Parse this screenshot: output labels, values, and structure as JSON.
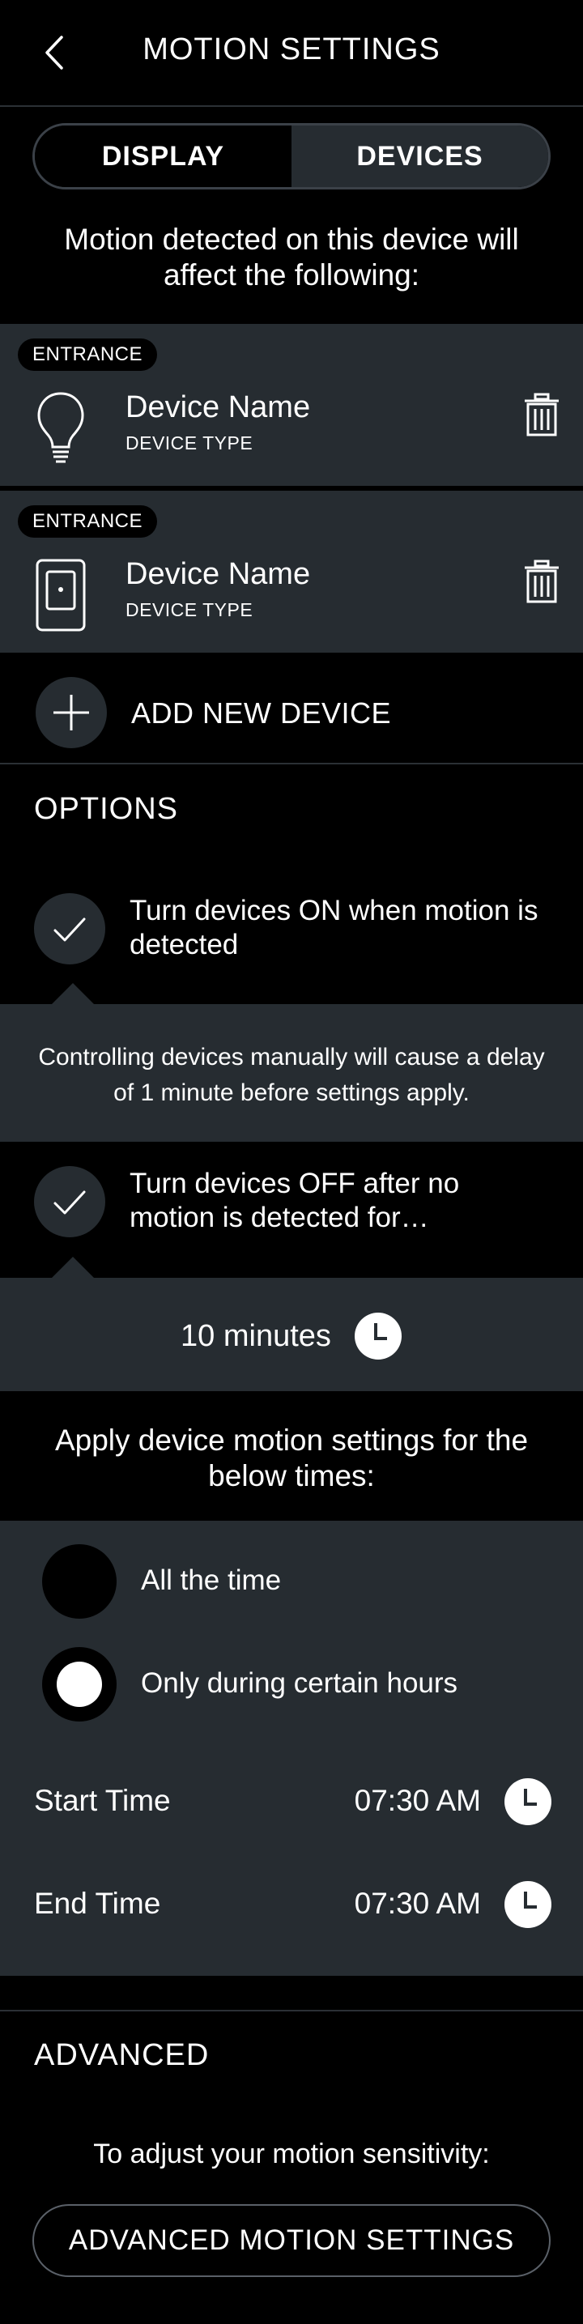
{
  "header": {
    "title": "MOTION SETTINGS"
  },
  "tabs": [
    {
      "label": "DISPLAY",
      "active": true
    },
    {
      "label": "DEVICES",
      "active": false
    }
  ],
  "intro": "Motion detected on this device will affect the following:",
  "devices": [
    {
      "tag": "ENTRANCE",
      "name": "Device Name",
      "type": "DEVICE TYPE",
      "icon": "light-bulb-icon"
    },
    {
      "tag": "ENTRANCE",
      "name": "Device Name",
      "type": "DEVICE TYPE",
      "icon": "switch-device-icon"
    }
  ],
  "add_device": {
    "label": "ADD NEW DEVICE"
  },
  "options": {
    "title": "OPTIONS",
    "turn_on": {
      "label": "Turn devices ON when motion is detected",
      "checked": true
    },
    "info": "Controlling devices manually will cause a delay of 1 minute before settings apply.",
    "turn_off": {
      "label": "Turn devices OFF after no motion is detected for…",
      "checked": true
    },
    "duration": "10 minutes"
  },
  "schedule": {
    "title": "Apply device motion settings for the below times:",
    "choices": [
      {
        "label": "All the time",
        "selected": false
      },
      {
        "label": "Only during certain hours",
        "selected": true
      }
    ],
    "start": {
      "label": "Start Time",
      "value": "07:30 AM"
    },
    "end": {
      "label": "End Time",
      "value": "07:30 AM"
    }
  },
  "advanced": {
    "title": "ADVANCED",
    "text": "To adjust your motion sensitivity:",
    "button": "ADVANCED MOTION SETTINGS"
  },
  "colors": {
    "background": "#000000",
    "panel": "#262c31",
    "divider": "#2b3035",
    "text": "#ffffff"
  }
}
